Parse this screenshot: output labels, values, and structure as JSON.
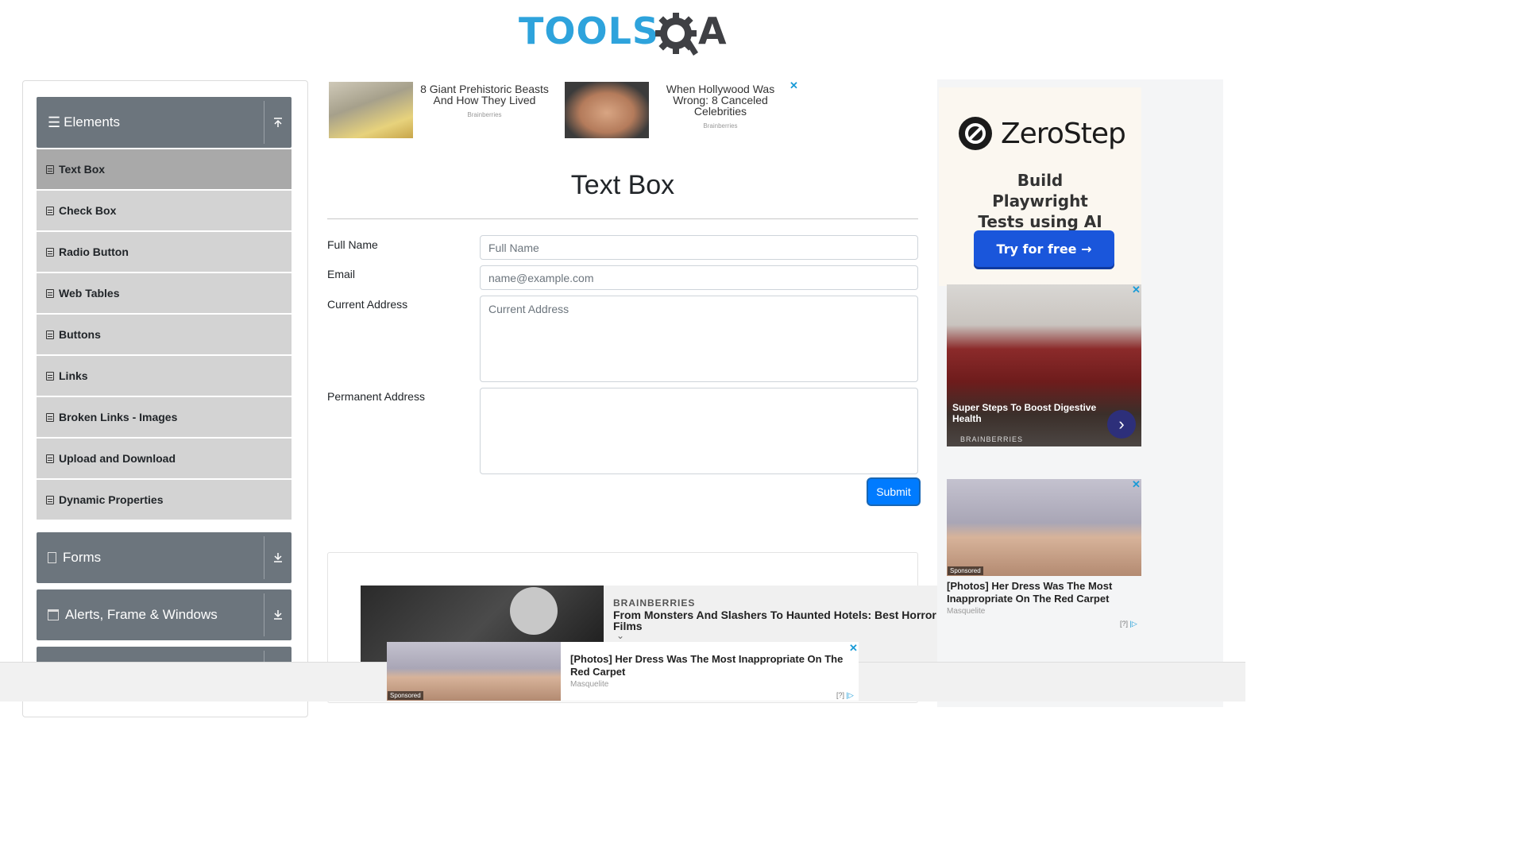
{
  "logo": {
    "text_tools": "TOOLS",
    "text_a": "A"
  },
  "sidebar": {
    "groups": [
      {
        "label": "Elements",
        "icon": "hamburger-icon",
        "toggle": "collapse-up-icon"
      },
      {
        "label": "Forms",
        "icon": "form-icon",
        "toggle": "expand-down-icon"
      },
      {
        "label": "Alerts, Frame & Windows",
        "icon": "window-icon",
        "toggle": "expand-down-icon"
      }
    ],
    "items": [
      {
        "label": "Text Box",
        "active": true
      },
      {
        "label": "Check Box"
      },
      {
        "label": "Radio Button"
      },
      {
        "label": "Web Tables"
      },
      {
        "label": "Buttons"
      },
      {
        "label": "Links"
      },
      {
        "label": "Broken Links - Images"
      },
      {
        "label": "Upload and Download"
      },
      {
        "label": "Dynamic Properties"
      }
    ]
  },
  "top_ads": [
    {
      "title": "8 Giant Prehistoric Beasts And How They Lived",
      "source": "Brainberries"
    },
    {
      "title": "When Hollywood Was Wrong: 8 Canceled Celebrities",
      "source": "Brainberries"
    }
  ],
  "main": {
    "title": "Text Box",
    "fields": {
      "full_name": {
        "label": "Full Name",
        "placeholder": "Full Name"
      },
      "email": {
        "label": "Email",
        "placeholder": "name@example.com"
      },
      "current_address": {
        "label": "Current Address",
        "placeholder": "Current Address"
      },
      "permanent_address": {
        "label": "Permanent Address",
        "placeholder": ""
      }
    },
    "submit": "Submit"
  },
  "right_ads": {
    "zerostep": {
      "name": "ZeroStep",
      "tagline": "Build Playwright Tests using AI",
      "cta": "Try for free →"
    },
    "meat": {
      "caption": "Super Steps To Boost Digestive Health",
      "source": "BRAINBERRIES"
    },
    "dress": {
      "caption": "[Photos] Her Dress Was The Most Inappropriate On The Red Carpet",
      "source": "Masquelite",
      "sponsored": "Sponsored",
      "adchoice": "[?]"
    }
  },
  "bottom_ads": {
    "brainberries": {
      "brand": "BRAINBERRIES",
      "title": "From Monsters And Slashers To Haunted Hotels: Best Horror Films"
    },
    "sticky": {
      "caption": "[Photos] Her Dress Was The Most Inappropriate On The Red Carpet",
      "source": "Masquelite",
      "sponsored": "Sponsored",
      "adchoice": "[?]"
    }
  },
  "colors": {
    "brand_blue": "#2ea3dc",
    "sidebar_header": "#6c757d",
    "submit": "#007bff",
    "zerostep_cta": "#1a56db"
  }
}
